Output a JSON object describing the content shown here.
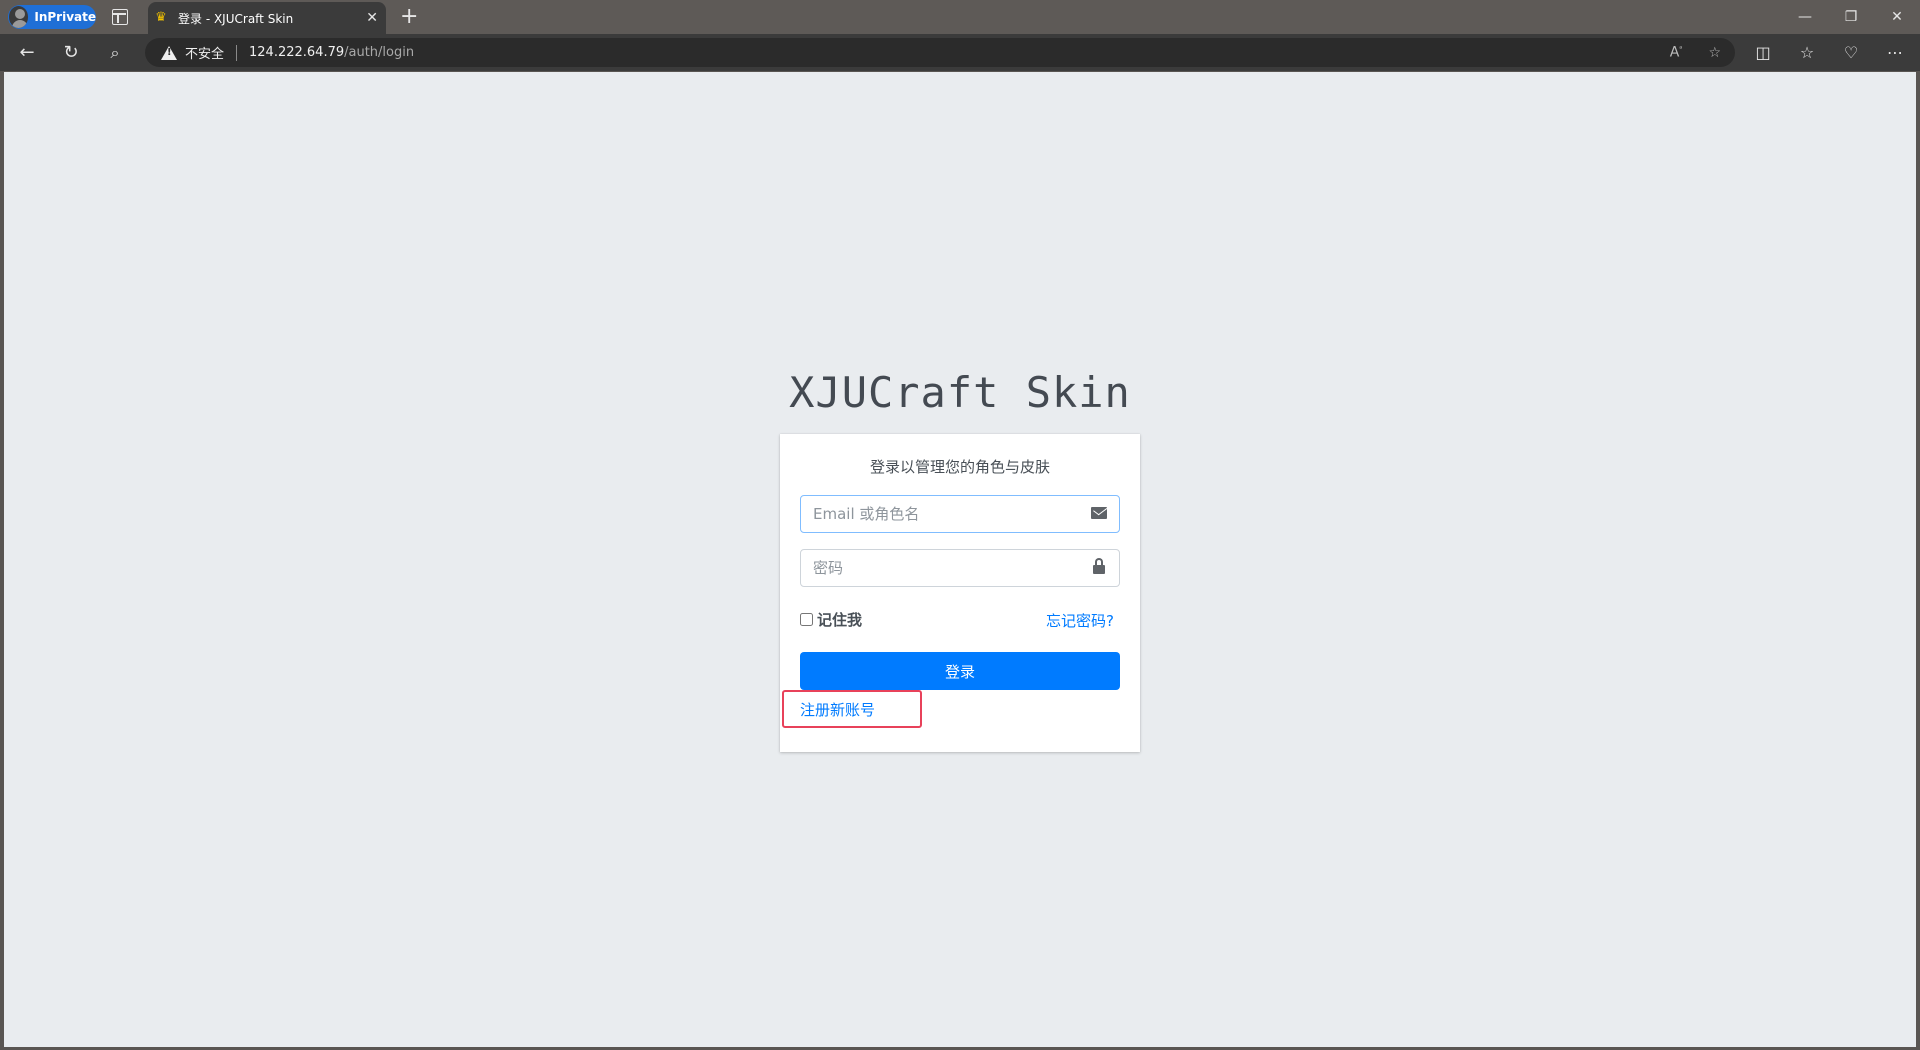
{
  "browser": {
    "inprivate_label": "InPrivate",
    "tab_title": "登录 - XJUCraft Skin",
    "tab_close": "✕",
    "new_tab": "+",
    "security_label": "不安全",
    "url_host": "124.222.64.79",
    "url_path": "/auth/login",
    "window_controls": {
      "minimize": "—",
      "restore": "❐",
      "close": "✕"
    }
  },
  "page": {
    "brand": "XJUCraft Skin",
    "card_message": "登录以管理您的角色与皮肤",
    "email_placeholder": "Email 或角色名",
    "password_placeholder": "密码",
    "remember_label": "记住我",
    "forgot_link": "忘记密码?",
    "login_button": "登录",
    "register_link": "注册新账号"
  },
  "colors": {
    "accent": "#007bff",
    "highlight": "#e8415a",
    "background": "#e9ecef"
  },
  "icons": [
    "back-icon",
    "refresh-icon",
    "search-icon",
    "warning-icon",
    "read-aloud-icon",
    "favorite-icon",
    "split-screen-icon",
    "favorites-icon",
    "browser-essentials-icon",
    "more-icon",
    "envelope-icon",
    "lock-icon"
  ]
}
